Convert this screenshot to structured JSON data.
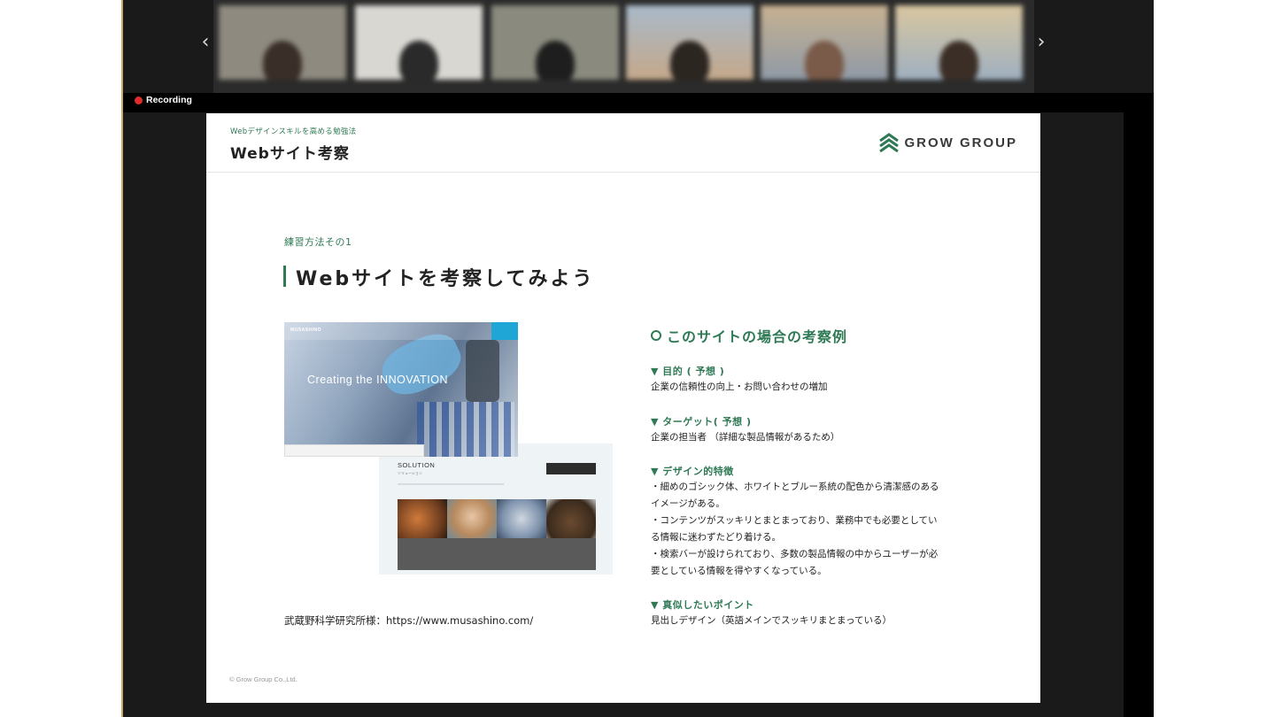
{
  "zoom": {
    "recording_label": "Recording",
    "gallery": {
      "prev_icon": "chevron-left-icon",
      "next_icon": "chevron-right-icon",
      "prev_glyph": "‹",
      "next_glyph": "›",
      "participant_count_visible": 6
    },
    "accent_colors": {
      "recording": "#e02b2b"
    }
  },
  "slide": {
    "header": {
      "subtitle": "Webデザインスキルを高める勉強法",
      "title": "Webサイト考察",
      "logo_text": "GROW GROUP",
      "logo_icon": "grow-group-logo-icon"
    },
    "practice_label": "練習方法その1",
    "main_title": "Webサイトを考察してみよう",
    "screenshot_top": {
      "site_logo": "MUSASHINO",
      "hero_text": "Creating the INNOVATION"
    },
    "screenshot_bottom": {
      "section_title": "SOLUTION",
      "section_subtitle": "ソリューション"
    },
    "source": "武蔵野科学研究所様：https://www.musashino.com/",
    "consideration": {
      "title": "このサイトの場合の考察例",
      "items": [
        {
          "head": "▼ 目的 ( 予想 )",
          "body": [
            "企業の信頼性の向上・お問い合わせの増加"
          ]
        },
        {
          "head": "▼ ターゲット( 予想 )",
          "body": [
            "企業の担当者 （詳細な製品情報があるため）"
          ]
        },
        {
          "head": "▼ デザイン的特徴",
          "body": [
            "・細めのゴシック体、ホワイトとブルー系統の配色から清潔感のある",
            "イメージがある。",
            "・コンテンツがスッキリとまとまっており、業務中でも必要としてい",
            "る情報に迷わずたどり着ける。",
            "・検索バーが設けられており、多数の製品情報の中からユーザーが必",
            "要としている情報を得やすくなっている。"
          ]
        },
        {
          "head": "▼ 真似したいポイント",
          "body": [
            "見出しデザイン（英語メインでスッキリまとまっている）"
          ]
        }
      ]
    },
    "copyright": "© Grow Group Co.,Ltd.",
    "colors": {
      "accent_green": "#2f7a55"
    }
  }
}
